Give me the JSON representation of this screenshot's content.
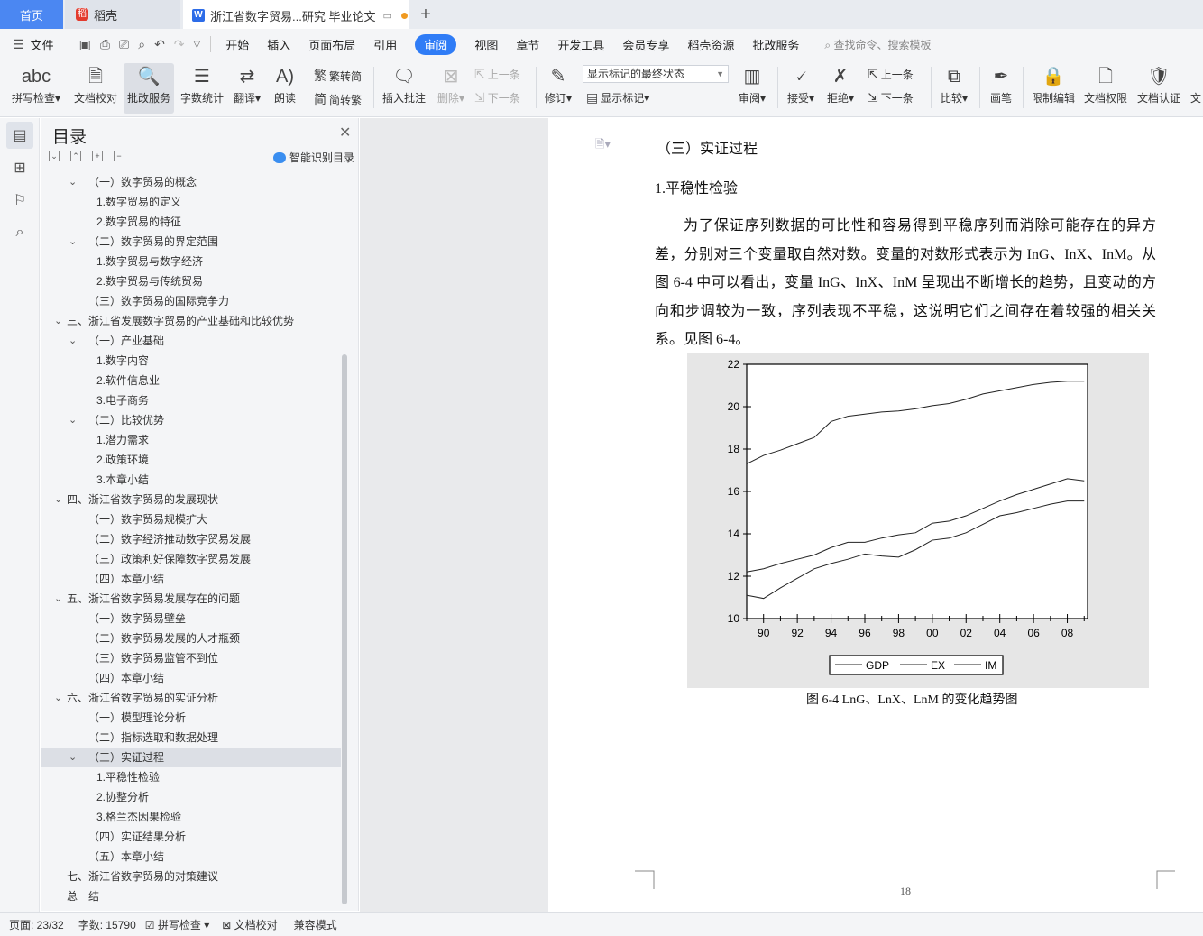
{
  "tabs": {
    "home": "首页",
    "daoke": "稻壳",
    "doc": "浙江省数字贸易...研究 毕业论文"
  },
  "menu": {
    "file": "文件",
    "items": [
      "开始",
      "插入",
      "页面布局",
      "引用",
      "审阅",
      "视图",
      "章节",
      "开发工具",
      "会员专享",
      "稻壳资源",
      "批改服务"
    ],
    "active": "审阅",
    "search": "查找命令、搜索模板"
  },
  "ribbon": {
    "spell": "拼写检查",
    "proof": "文档校对",
    "review_service": "批改服务",
    "word_count": "字数统计",
    "translate": "翻译",
    "read": "朗读",
    "trad": "繁转简",
    "simp": "简转繁",
    "insert_comment": "插入批注",
    "delete": "删除",
    "prev_comment": "上一条",
    "next_comment": "下一条",
    "track": "修订",
    "markup_state": "显示标记的最终状态",
    "show_markup": "显示标记",
    "review": "审阅",
    "accept": "接受",
    "reject": "拒绝",
    "prev": "上一条",
    "next": "下一条",
    "compare": "比较",
    "pen": "画笔",
    "restrict": "限制编辑",
    "permission": "文档权限",
    "certify": "文档认证",
    "more": "文"
  },
  "toc": {
    "title": "目录",
    "ai": "智能识别目录",
    "items": [
      {
        "text": "（一）数字贸易的概念",
        "level": 2,
        "chev": true
      },
      {
        "text": "1.数字贸易的定义",
        "level": 3
      },
      {
        "text": "2.数字贸易的特征",
        "level": 3
      },
      {
        "text": "（二）数字贸易的界定范围",
        "level": 2,
        "chev": true
      },
      {
        "text": "1.数字贸易与数字经济",
        "level": 3
      },
      {
        "text": "2.数字贸易与传统贸易",
        "level": 3
      },
      {
        "text": "（三）数字贸易的国际竞争力",
        "level": 2
      },
      {
        "text": "三、浙江省发展数字贸易的产业基础和比较优势",
        "level": 1,
        "chev": true
      },
      {
        "text": "（一）产业基础",
        "level": 2,
        "chev": true
      },
      {
        "text": "1.数字内容",
        "level": 3
      },
      {
        "text": "2.软件信息业",
        "level": 3
      },
      {
        "text": "3.电子商务",
        "level": 3
      },
      {
        "text": "（二）比较优势",
        "level": 2,
        "chev": true
      },
      {
        "text": "1.潜力需求",
        "level": 3
      },
      {
        "text": "2.政策环境",
        "level": 3
      },
      {
        "text": "3.本章小结",
        "level": 3
      },
      {
        "text": "四、浙江省数字贸易的发展现状",
        "level": 1,
        "chev": true
      },
      {
        "text": "（一）数字贸易规模扩大",
        "level": 2
      },
      {
        "text": "（二）数字经济推动数字贸易发展",
        "level": 2
      },
      {
        "text": "（三）政策利好保障数字贸易发展",
        "level": 2
      },
      {
        "text": "（四）本章小结",
        "level": 2
      },
      {
        "text": "五、浙江省数字贸易发展存在的问题",
        "level": 1,
        "chev": true
      },
      {
        "text": "（一）数字贸易壁垒",
        "level": 2
      },
      {
        "text": "（二）数字贸易发展的人才瓶颈",
        "level": 2
      },
      {
        "text": "（三）数字贸易监管不到位",
        "level": 2
      },
      {
        "text": "（四）本章小结",
        "level": 2
      },
      {
        "text": "六、浙江省数字贸易的实证分析",
        "level": 1,
        "chev": true
      },
      {
        "text": "（一）模型理论分析",
        "level": 2
      },
      {
        "text": "（二）指标选取和数据处理",
        "level": 2
      },
      {
        "text": "（三）实证过程",
        "level": 2,
        "chev": true,
        "selected": true
      },
      {
        "text": "1.平稳性检验",
        "level": 3
      },
      {
        "text": "2.协整分析",
        "level": 3
      },
      {
        "text": "3.格兰杰因果检验",
        "level": 3
      },
      {
        "text": "（四）实证结果分析",
        "level": 2
      },
      {
        "text": "（五）本章小结",
        "level": 2
      },
      {
        "text": "七、浙江省数字贸易的对策建议",
        "level": 1
      },
      {
        "text": "总　结",
        "level": 1
      }
    ]
  },
  "document": {
    "section": "（三）实证过程",
    "subsection": "1.平稳性检验",
    "paragraph": "为了保证序列数据的可比性和容易得到平稳序列而消除可能存在的异方差，分别对三个变量取自然对数。变量的对数形式表示为 InG、InX、InM。从图 6-4 中可以看出，变量 InG、InX、InM 呈现出不断增长的趋势，且变动的方向和步调较为一致，序列表现不平稳，这说明它们之间存在着较强的相关关系。见图 6-4。",
    "caption": "图 6-4 LnG、LnX、LnM 的变化趋势图",
    "page_number": "18"
  },
  "chart_data": {
    "type": "line",
    "title": "",
    "xlabel": "",
    "ylabel": "",
    "x": [
      1989,
      1990,
      1991,
      1992,
      1993,
      1994,
      1995,
      1996,
      1997,
      1998,
      1999,
      2000,
      2001,
      2002,
      2003,
      2004,
      2005,
      2006,
      2007,
      2008,
      2009
    ],
    "xticks": [
      "90",
      "92",
      "94",
      "96",
      "98",
      "00",
      "02",
      "04",
      "06",
      "08"
    ],
    "xtick_years": [
      1990,
      1992,
      1994,
      1996,
      1998,
      2000,
      2002,
      2004,
      2006,
      2008
    ],
    "yticks": [
      10,
      12,
      14,
      16,
      18,
      20,
      22
    ],
    "ylim": [
      10,
      22
    ],
    "xlim": [
      1989,
      2009.2
    ],
    "legend_position": "bottom",
    "series": [
      {
        "name": "GDP",
        "values": [
          17.3,
          17.7,
          17.95,
          18.25,
          18.55,
          19.3,
          19.55,
          19.65,
          19.75,
          19.8,
          19.9,
          20.05,
          20.15,
          20.35,
          20.6,
          20.75,
          20.9,
          21.05,
          21.15,
          21.2,
          21.2
        ]
      },
      {
        "name": "EX",
        "values": [
          12.2,
          12.35,
          12.6,
          12.8,
          13.0,
          13.35,
          13.6,
          13.6,
          13.8,
          13.95,
          14.05,
          14.5,
          14.6,
          14.85,
          15.2,
          15.55,
          15.85,
          16.1,
          16.35,
          16.6,
          16.5
        ]
      },
      {
        "name": "IM",
        "values": [
          11.1,
          10.95,
          11.45,
          11.9,
          12.35,
          12.6,
          12.8,
          13.05,
          12.95,
          12.9,
          13.25,
          13.7,
          13.8,
          14.05,
          14.45,
          14.85,
          15.0,
          15.2,
          15.4,
          15.55,
          15.55
        ]
      }
    ]
  },
  "status": {
    "page": "页面: 23/32",
    "words": "字数: 15790",
    "spell": "拼写检查",
    "proof": "文档校对",
    "mode": "兼容模式"
  }
}
